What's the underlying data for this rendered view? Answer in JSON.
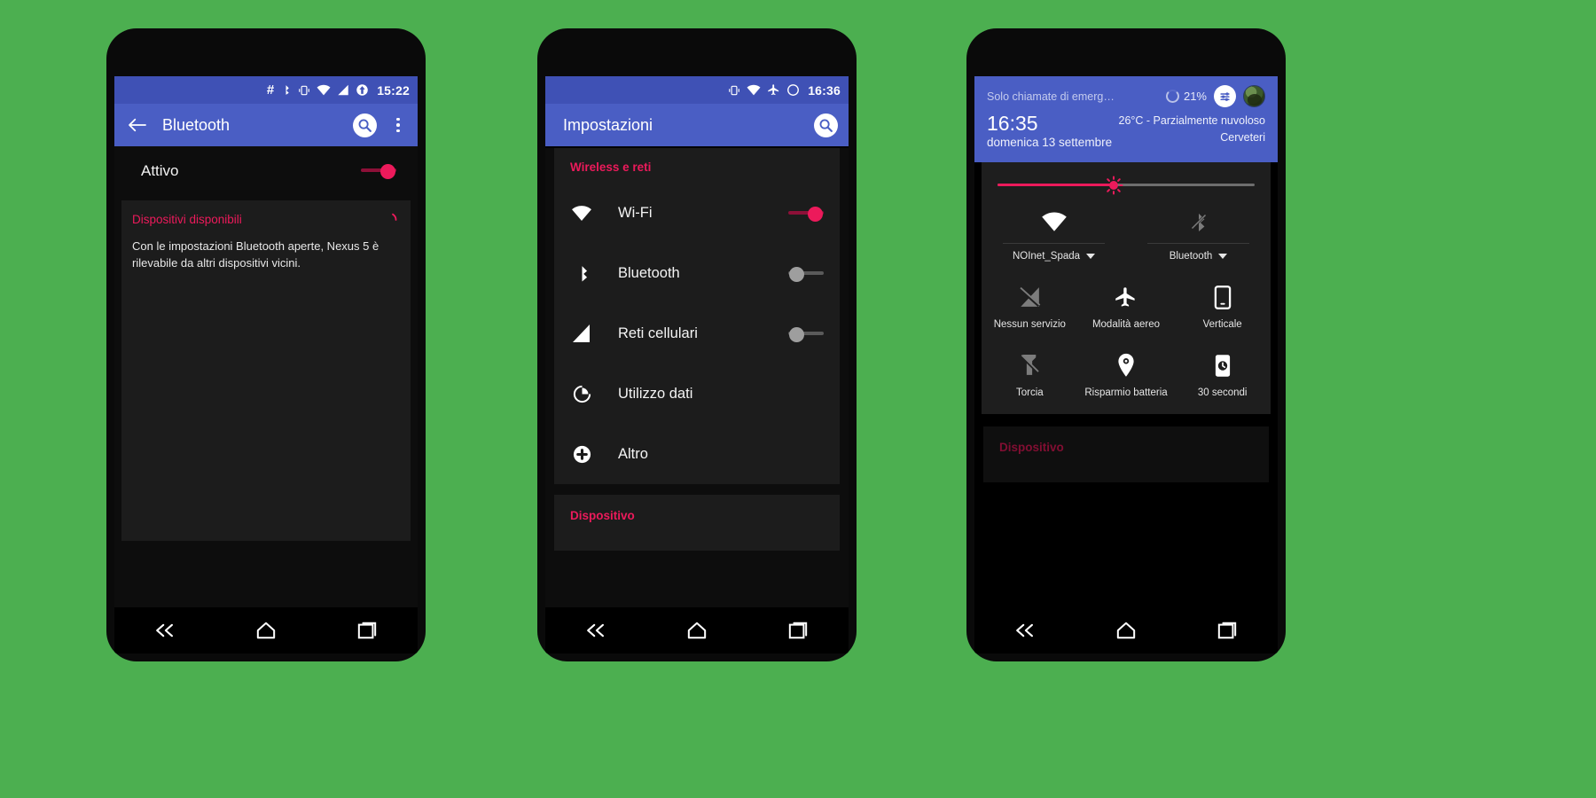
{
  "background_color": "#4caf50",
  "accent_pink": "#ec1a5b",
  "appbar_blue": "#4a5ec4",
  "statusbar_blue": "#3f51b5",
  "phone1": {
    "statusbar": {
      "time": "15:22",
      "icons": [
        "hash-icon",
        "bluetooth-icon",
        "vibrate-icon",
        "wifi-icon",
        "cell-signal-icon",
        "sync-icon"
      ]
    },
    "appbar": {
      "back_label": "back-arrow",
      "title": "Bluetooth",
      "search_label": "search-icon",
      "overflow_label": "more-options"
    },
    "toggle_row": {
      "label": "Attivo",
      "state": "on"
    },
    "section": {
      "header": "Dispositivi disponibili",
      "description": "Con le impostazioni Bluetooth aperte, Nexus 5 è rilevabile da altri dispositivi vicini."
    },
    "navbar": [
      "back-nav-icon",
      "home-nav-icon",
      "recents-nav-icon"
    ]
  },
  "phone2": {
    "statusbar": {
      "time": "16:36",
      "icons": [
        "vibrate-icon",
        "wifi-icon",
        "airplane-icon",
        "sync-icon"
      ]
    },
    "appbar": {
      "title": "Impostazioni",
      "search_label": "search-icon"
    },
    "sections": [
      {
        "header": "Wireless e reti",
        "rows": [
          {
            "icon": "wifi-icon",
            "label": "Wi-Fi",
            "toggle": "on"
          },
          {
            "icon": "bluetooth-icon",
            "label": "Bluetooth",
            "toggle": "off"
          },
          {
            "icon": "cell-signal-icon",
            "label": "Reti cellulari",
            "toggle": "off"
          },
          {
            "icon": "data-usage-icon",
            "label": "Utilizzo dati",
            "toggle": "none"
          },
          {
            "icon": "plus-circle-icon",
            "label": "Altro",
            "toggle": "none"
          }
        ]
      },
      {
        "header": "Dispositivo",
        "rows": []
      }
    ],
    "navbar": [
      "back-nav-icon",
      "home-nav-icon",
      "recents-nav-icon"
    ]
  },
  "phone3": {
    "shade": {
      "carrier": "Solo chiamate di emerg…",
      "battery_percent": "21%",
      "clock": "16:35",
      "date": "domenica 13 settembre",
      "weather": "26°C - Parzialmente nuvoloso",
      "location": "Cerveteri",
      "settings_label": "quick-settings-icon",
      "avatar_label": "user-avatar"
    },
    "brightness": {
      "value_percent": 45
    },
    "top_tiles": [
      {
        "icon": "wifi-icon",
        "label": "NOInet_Spada",
        "state": "on",
        "has_caret": true
      },
      {
        "icon": "bluetooth-off-icon",
        "label": "Bluetooth",
        "state": "off",
        "has_caret": true
      }
    ],
    "tiles": [
      {
        "icon": "no-signal-icon",
        "label": "Nessun servizio",
        "state": "off"
      },
      {
        "icon": "airplane-icon",
        "label": "Modalità aereo",
        "state": "on"
      },
      {
        "icon": "rotation-lock-icon",
        "label": "Verticale",
        "state": "on"
      },
      {
        "icon": "flashlight-off-icon",
        "label": "Torcia",
        "state": "off"
      },
      {
        "icon": "location-icon",
        "label": "Risparmio batteria",
        "state": "on"
      },
      {
        "icon": "timer-icon",
        "label": "30 secondi",
        "state": "on"
      }
    ],
    "bottom_section": {
      "header": "Dispositivo"
    },
    "navbar": [
      "back-nav-icon",
      "home-nav-icon",
      "recents-nav-icon"
    ]
  }
}
